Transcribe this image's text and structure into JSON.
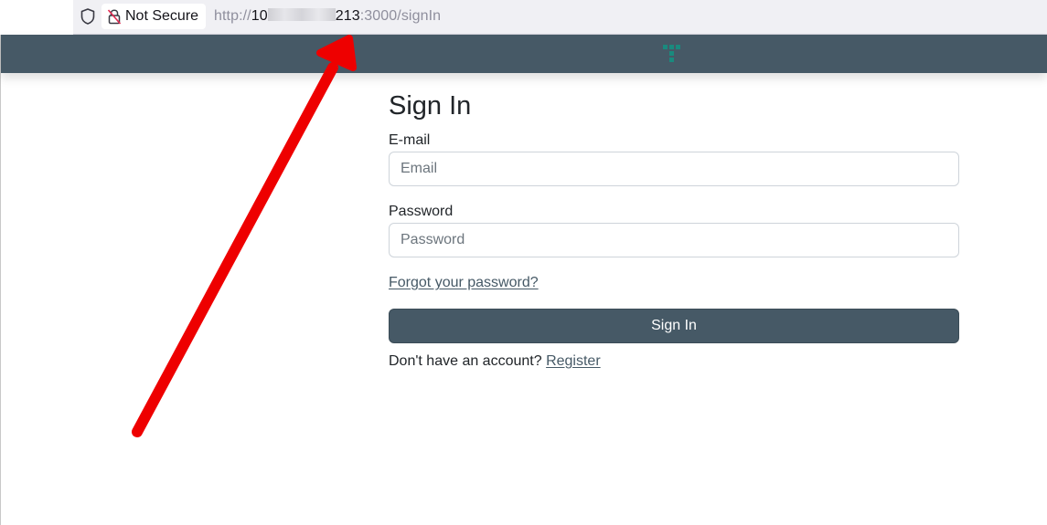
{
  "browser": {
    "security_label": "Not Secure",
    "url_scheme": "http://",
    "url_host_start": "10",
    "url_host_end": "213",
    "url_rest": ":3000/signIn",
    "shield_icon": "shield-icon",
    "lock_icon": "lock-broken-icon"
  },
  "navbar": {
    "logo_icon": "app-logo-icon",
    "color": "#465966",
    "logo_color": "#1a8a7e"
  },
  "form": {
    "title": "Sign In",
    "email_label": "E-mail",
    "email_placeholder": "Email",
    "email_value": "",
    "password_label": "Password",
    "password_placeholder": "Password",
    "password_value": "",
    "forgot_link": "Forgot your password?",
    "submit_label": "Sign In",
    "no_account_text": "Don't have an account?",
    "register_link": "Register"
  },
  "annotation": {
    "arrow_color": "#ff0000",
    "arrow_icon": "red-arrow-annotation"
  }
}
